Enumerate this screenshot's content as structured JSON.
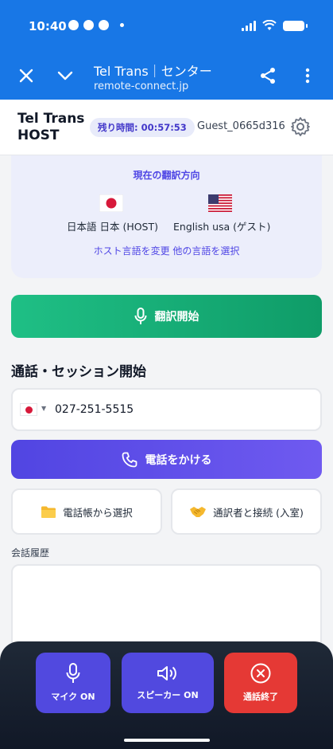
{
  "status_bar": {
    "time": "10:40"
  },
  "browser": {
    "title": "Tel Trans｜センター",
    "url": "remote-connect.jp"
  },
  "app_header": {
    "brand_line1": "Tel Trans",
    "brand_line2": "HOST",
    "timer": "残り時間: 00:57:53",
    "guest": "Guest_0665d316"
  },
  "direction": {
    "title": "現在の翻訳方向",
    "host_lang": "日本語 日本 (HOST)",
    "guest_lang": "English usa (ゲスト)",
    "link_change_host": "ホスト言語を変更",
    "link_select_other": "他の言語を選択"
  },
  "start_button": {
    "label": "翻訳開始"
  },
  "call_section": {
    "title": "通話・セッション開始",
    "phone_value": "027-251-5515",
    "call_label": "電話をかける",
    "contacts_label": "電話帳から選択",
    "connect_label": "通訳者と接続 (入室)"
  },
  "history": {
    "label": "会話履歴"
  },
  "controls": {
    "mic_label": "マイク ON",
    "speaker_label": "スピーカー ON",
    "end_label": "通話終了"
  },
  "colors": {
    "browser_blue": "#1877e6",
    "accent_indigo": "#5149df",
    "start_green": "#1fbf85",
    "end_red": "#e53935"
  }
}
